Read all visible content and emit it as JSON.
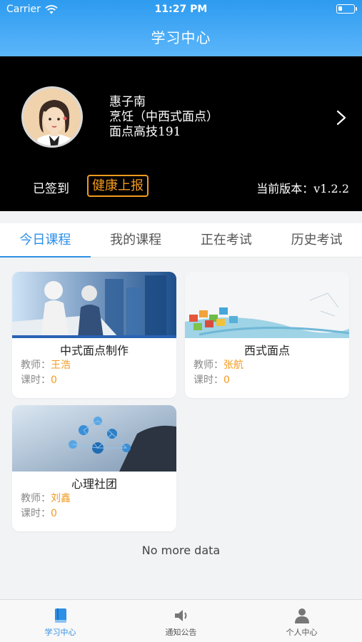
{
  "status": {
    "carrier": "Carrier",
    "time": "11:27 PM"
  },
  "nav": {
    "title": "学习中心"
  },
  "profile": {
    "name": "惠子南",
    "major": "烹饪（中西式面点）",
    "class": "面点高技191",
    "signin_status": "已签到",
    "health_report_label": "健康上报",
    "version_label": "当前版本：",
    "version_value": "v1.2.2"
  },
  "tabs": [
    {
      "label": "今日课程",
      "active": true
    },
    {
      "label": "我的课程",
      "active": false
    },
    {
      "label": "正在考试",
      "active": false
    },
    {
      "label": "历史考试",
      "active": false
    }
  ],
  "courses": [
    {
      "title": "中式面点制作",
      "teacher_label": "教师：",
      "teacher": "王浩",
      "hours_label": "课时：",
      "hours": "0"
    },
    {
      "title": "西式面点",
      "teacher_label": "教师：",
      "teacher": "张航",
      "hours_label": "课时：",
      "hours": "0"
    },
    {
      "title": "心理社团",
      "teacher_label": "教师：",
      "teacher": "刘鑫",
      "hours_label": "课时：",
      "hours": "0"
    }
  ],
  "list_footer": "No more data",
  "tabbar": [
    {
      "label": "学习中心",
      "icon": "book-icon",
      "active": true
    },
    {
      "label": "通知公告",
      "icon": "speaker-icon",
      "active": false
    },
    {
      "label": "个人中心",
      "icon": "person-icon",
      "active": false
    }
  ],
  "colors": {
    "accent": "#2d8fe6",
    "highlight": "#f39a1e",
    "header": "#2d9bf0"
  }
}
